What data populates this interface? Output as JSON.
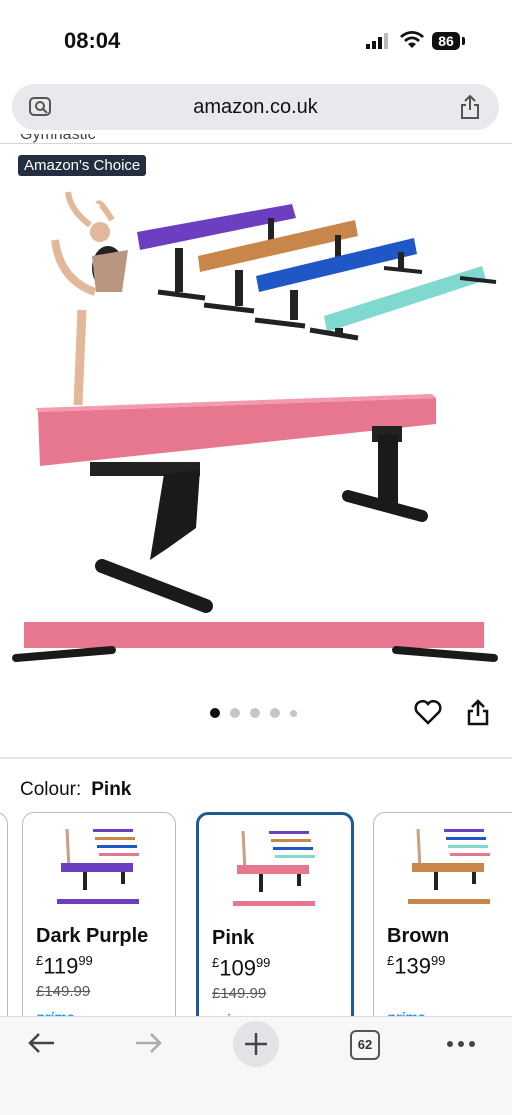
{
  "status": {
    "time": "08:04",
    "battery": "86"
  },
  "browser": {
    "url": "amazon.co.uk",
    "tab_count": "62"
  },
  "product": {
    "title_fragment": "Gymnastic",
    "badge": "Amazon's Choice",
    "image_dots": 5,
    "active_dot": 1
  },
  "colour": {
    "label": "Colour:",
    "selected": "Pink",
    "options": [
      {
        "name": "",
        "price_whole": "",
        "price_frac": "",
        "was": ""
      },
      {
        "name": "Dark Purple",
        "currency": "£",
        "price_whole": "119",
        "price_frac": "99",
        "was": "£149.99",
        "prime": "prime"
      },
      {
        "name": "Pink",
        "currency": "£",
        "price_whole": "109",
        "price_frac": "99",
        "was": "£149.99",
        "prime": "prime"
      },
      {
        "name": "Brown",
        "currency": "£",
        "price_whole": "139",
        "price_frac": "99",
        "was": "",
        "prime": "prime"
      }
    ]
  },
  "colors": {
    "pink": "#e7768f",
    "purple": "#6b3fbf",
    "tan": "#c9864a",
    "blue": "#1f58c6",
    "teal": "#7fd9cf",
    "selected_border": "#1f5a94"
  }
}
